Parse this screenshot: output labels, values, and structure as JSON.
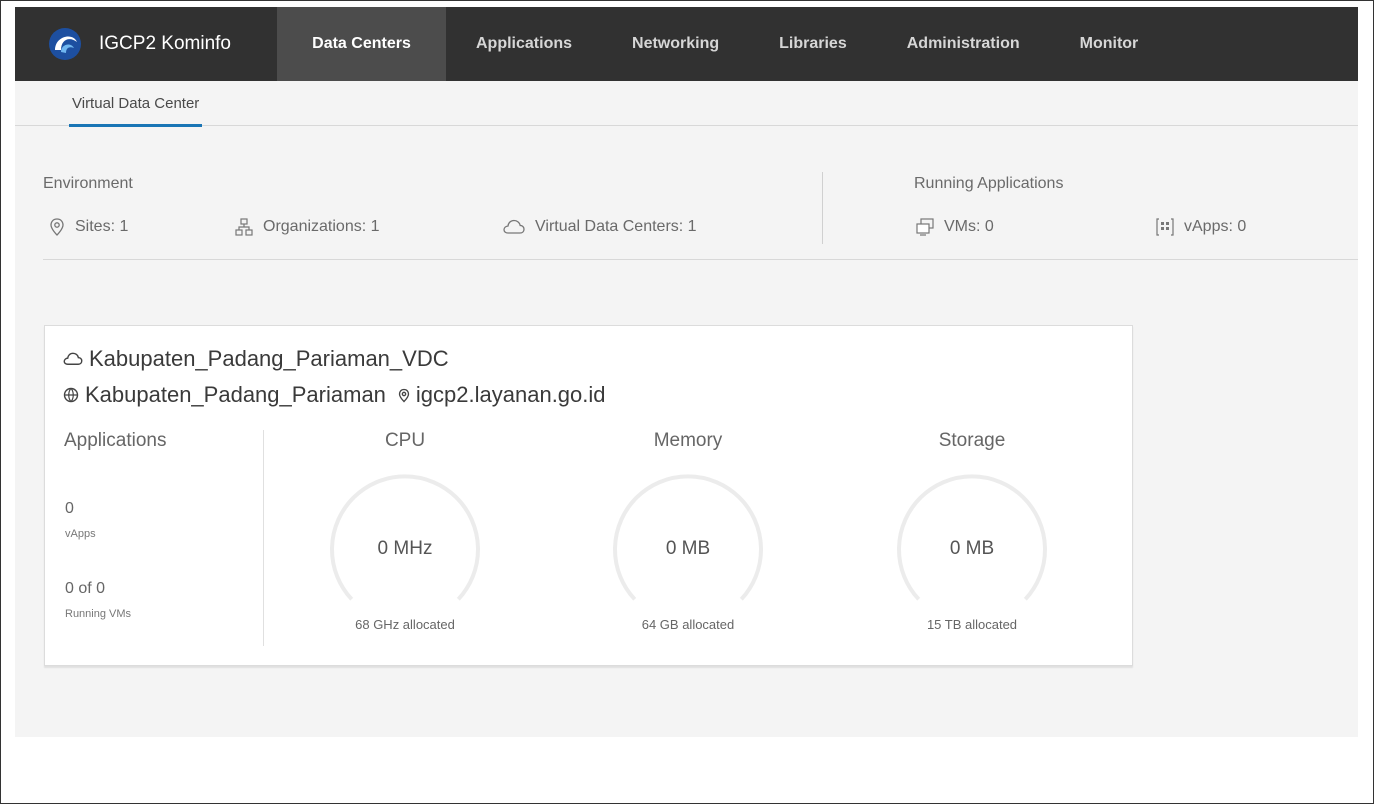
{
  "header": {
    "app_title": "IGCP2 Kominfo",
    "nav": [
      "Data Centers",
      "Applications",
      "Networking",
      "Libraries",
      "Administration",
      "Monitor"
    ],
    "active_nav": "Data Centers"
  },
  "subnav": {
    "tab": "Virtual Data Center"
  },
  "environment": {
    "title": "Environment",
    "sites": "Sites: 1",
    "organizations": "Organizations: 1",
    "vdcs": "Virtual Data Centers: 1"
  },
  "running": {
    "title": "Running Applications",
    "vms": "VMs: 0",
    "vapps": "vApps: 0"
  },
  "card": {
    "vdc_name": "Kabupaten_Padang_Pariaman_VDC",
    "org_name": "Kabupaten_Padang_Pariaman",
    "site": "igcp2.layanan.go.id",
    "applications": {
      "title": "Applications",
      "vapps_value": "0",
      "vapps_label": "vApps",
      "vms_value": "0 of 0",
      "vms_label": "Running VMs"
    },
    "cpu": {
      "title": "CPU",
      "value": "0 MHz",
      "allocated": "68 GHz allocated"
    },
    "memory": {
      "title": "Memory",
      "value": "0 MB",
      "allocated": "64 GB allocated"
    },
    "storage": {
      "title": "Storage",
      "value": "0 MB",
      "allocated": "15 TB allocated"
    }
  },
  "colors": {
    "header_bg": "#313131",
    "active_tab_bg": "#4c4c4c",
    "accent": "#1a75b5",
    "gauge_track": "#ececec"
  },
  "icons": [
    "logo-icon",
    "pin-icon",
    "org-tree-icon",
    "cloud-icon",
    "vm-icon",
    "vapp-icon",
    "globe-icon"
  ]
}
